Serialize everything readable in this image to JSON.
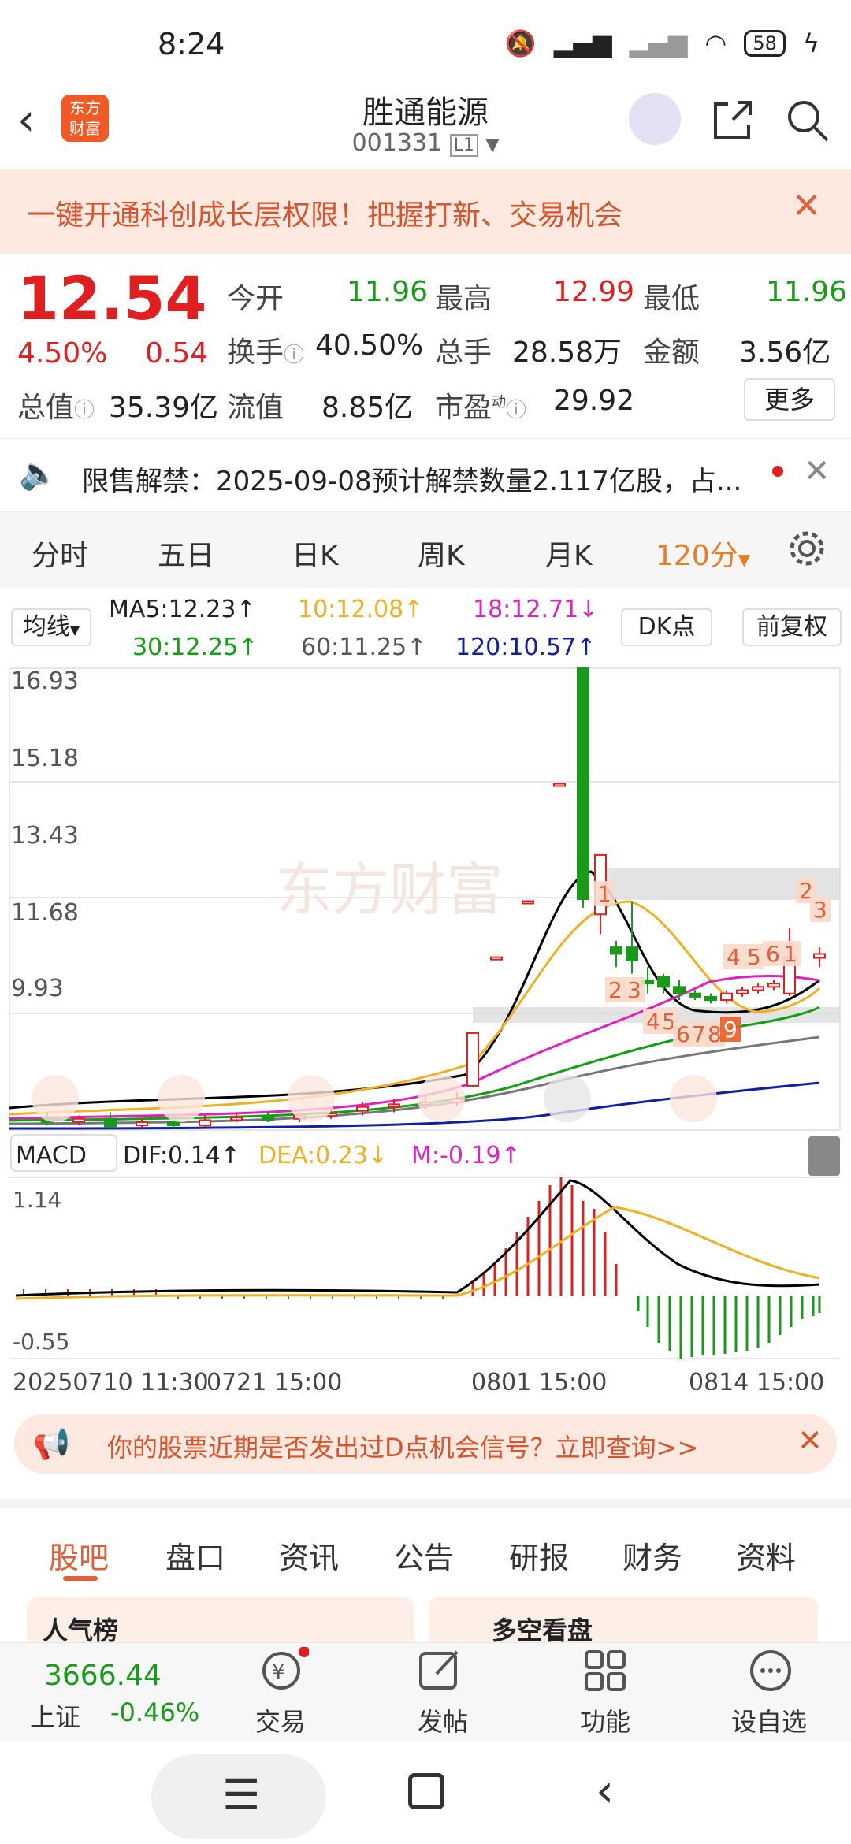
{
  "status_bar": {
    "time": "8:24",
    "battery": "58"
  },
  "header": {
    "logo_line1": "东方",
    "logo_line2": "财富",
    "title": "胜通能源",
    "code": "001331",
    "market_badge": "L1"
  },
  "banner": {
    "text": "一键开通科创成长层权限！把握打新、交易机会"
  },
  "quote": {
    "price": "12.54",
    "change_pct": "4.50%",
    "change": "0.54",
    "open_label": "今开",
    "open": "11.96",
    "high_label": "最高",
    "high": "12.99",
    "low_label": "最低",
    "low": "11.96",
    "turnover_label": "换手",
    "turnover": "40.50%",
    "volume_label": "总手",
    "volume": "28.58万",
    "amount_label": "金额",
    "amount": "3.56亿",
    "mktcap_label": "总值",
    "mktcap": "35.39亿",
    "float_label": "流值",
    "float": "8.85亿",
    "pe_label": "市盈",
    "pe_sup": "动",
    "pe": "29.92",
    "more_label": "更多"
  },
  "notice": {
    "text": "限售解禁：2025-09-08预计解禁数量2.117亿股，占..."
  },
  "period_tabs": [
    "分时",
    "五日",
    "日K",
    "周K",
    "月K",
    "120分"
  ],
  "ma_bar": {
    "selector": "均线",
    "ma5": "MA5:12.23↑",
    "ma10": "10:12.08↑",
    "ma18": "18:12.71↓",
    "ma30": "30:12.25↑",
    "ma60": "60:11.25↑",
    "ma120": "120:10.57↑",
    "dk_label": "DK点",
    "adjust_label": "前复权"
  },
  "chart_data": {
    "type": "candlestick",
    "y_ticks": [
      "16.93",
      "15.18",
      "13.43",
      "11.68",
      "9.93"
    ],
    "watermark": "东方财富",
    "markers": [
      "1",
      "2",
      "3",
      "4",
      "5",
      "6",
      "1",
      "2",
      "3",
      "4",
      "5",
      "6",
      "7",
      "8",
      "9"
    ],
    "x_ticks": [
      "20250710 11:30",
      "0721 15:00",
      "0801 15:00",
      "0814 15:00"
    ],
    "macd": {
      "selector": "MACD",
      "dif": "DIF:0.14↑",
      "dea": "DEA:0.23↓",
      "m": "M:-0.19↑",
      "ymax": "1.14",
      "ymin": "-0.55"
    },
    "colors": {
      "up": "#e02020",
      "down": "#1a9a1a",
      "ma5": "#000000",
      "ma10": "#f0b020",
      "ma18": "#e020c0",
      "ma30": "#10a010",
      "ma60": "#777777",
      "ma120": "#1020a0"
    }
  },
  "promo": {
    "text": "你的股票近期是否发出过D点机会信号？立即查询>>"
  },
  "bottom_tabs": [
    "股吧",
    "盘口",
    "资讯",
    "公告",
    "研报",
    "财务",
    "资料"
  ],
  "cards": {
    "left": "人气榜",
    "right": "多空看盘"
  },
  "index": {
    "value": "3666.44",
    "name": "上证",
    "change": "-0.46%"
  },
  "bottom_nav": [
    "交易",
    "发帖",
    "功能",
    "设自选"
  ]
}
